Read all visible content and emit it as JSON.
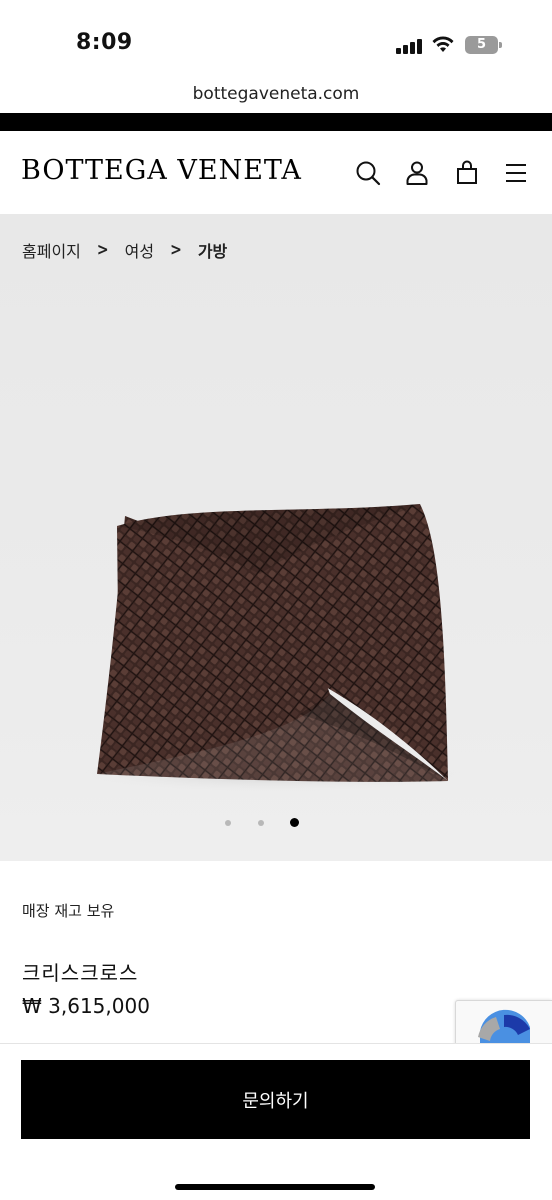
{
  "status_bar": {
    "time": "8:09",
    "battery_level": "5",
    "icons": [
      "signal-icon",
      "wifi-icon",
      "battery-icon"
    ]
  },
  "browser": {
    "url": "bottegaveneta.com"
  },
  "header": {
    "logo": "BOTTEGA VENETA",
    "icons": [
      "search-icon",
      "account-icon",
      "shopping-bag-icon",
      "menu-icon"
    ]
  },
  "breadcrumb": {
    "items": [
      "홈페이지",
      "여성",
      "가방"
    ],
    "separator": ">"
  },
  "gallery": {
    "total_images": 3,
    "active_index": 2
  },
  "product": {
    "stock_status": "매장 재고 보유",
    "name": "크리스크로스",
    "price": "₩ 3,615,000"
  },
  "actions": {
    "inquiry_label": "문의하기"
  },
  "colors": {
    "brand_black": "#000000",
    "image_background": "#ebebeb",
    "bag_brown": "#3b2622"
  }
}
